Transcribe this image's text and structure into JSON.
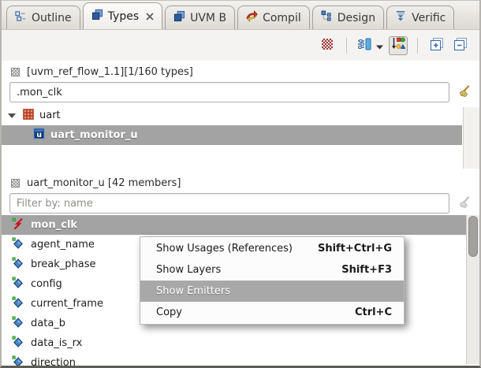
{
  "colors": {
    "selection_bg": "#a3a3a3",
    "menu_hover_bg": "#a8a8a8",
    "tab_bar_bg": "#ddd9d4",
    "content_bg": "#ffffff",
    "accent_blue": "#3465a4",
    "signal_red": "#c41616",
    "field_blue": "#4a86c8",
    "green_badge": "#4fc04f"
  },
  "tabs": [
    {
      "label": "Outline",
      "icon": "outline-icon"
    },
    {
      "label": "Types",
      "icon": "types-icon",
      "active": true,
      "closable": true
    },
    {
      "label": "UVM B",
      "icon": "types-icon"
    },
    {
      "label": "Compil",
      "icon": "compile-icon"
    },
    {
      "label": "Design",
      "icon": "design-icon"
    },
    {
      "label": "Verific",
      "icon": "verific-icon"
    }
  ],
  "window_controls": [
    {
      "name": "minimize",
      "icon": "minimize-icon"
    },
    {
      "name": "maximize",
      "icon": "maximize-icon"
    }
  ],
  "toolbar": {
    "group1": [
      {
        "name": "overlay-filter",
        "icon": "checker-red-icon",
        "enabled": false
      }
    ],
    "group2": [
      {
        "name": "filter-settings",
        "icon": "sliders-icon",
        "has_dropdown": true
      },
      {
        "name": "group-by-type",
        "icon": "group-by-icon",
        "toggled": true
      }
    ],
    "group3": [
      {
        "name": "expand-all",
        "icon": "expand-all-icon"
      },
      {
        "name": "collapse-all",
        "icon": "collapse-all-icon"
      }
    ]
  },
  "types_panel": {
    "header": "[uvm_ref_flow_1.1][1/160 types]",
    "search_value": ".mon_clk",
    "tree": [
      {
        "label": "uart",
        "icon": "module-icon",
        "level": 0,
        "expanded": true
      },
      {
        "label": "uart_monitor_u",
        "icon": "class-u-icon",
        "level": 1,
        "selected": true
      }
    ],
    "scroll_buttons": [
      {
        "name": "scroll-to-top",
        "icon": "scroll-top-icon"
      },
      {
        "name": "scroll-up-page",
        "icon": "scroll-dbl-icon"
      },
      {
        "name": "scroll-up-line",
        "icon": "scroll-one-icon",
        "enabled": false
      }
    ]
  },
  "members_panel": {
    "header": "uart_monitor_u [42 members]",
    "filter_placeholder": "Filter by: name",
    "members": [
      {
        "name": "mon_clk",
        "icon": "signal-icon",
        "selected": true
      },
      {
        "name": "agent_name",
        "icon": "field-icon"
      },
      {
        "name": "break_phase",
        "icon": "field-icon"
      },
      {
        "name": "config",
        "icon": "field-icon"
      },
      {
        "name": "current_frame",
        "icon": "field-icon"
      },
      {
        "name": "data_b",
        "icon": "field-icon"
      },
      {
        "name": "data_is_rx",
        "icon": "field-icon"
      },
      {
        "name": "direction",
        "icon": "field-icon"
      }
    ]
  },
  "context_menu": {
    "items": [
      {
        "label": "Show Usages (References)",
        "shortcut": "Shift+Ctrl+G"
      },
      {
        "label": "Show Layers",
        "shortcut": "Shift+F3"
      },
      {
        "label": "Show Emitters",
        "shortcut": "",
        "highlighted": true
      },
      {
        "label": "Copy",
        "shortcut": "Ctrl+C"
      }
    ]
  }
}
